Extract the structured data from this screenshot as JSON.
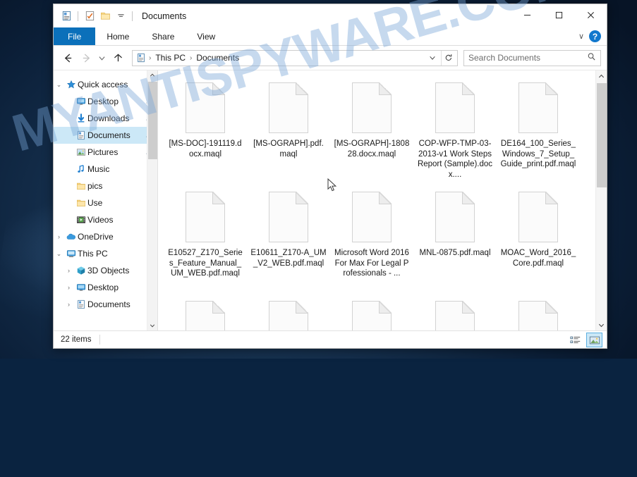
{
  "desktop": {
    "watermark": "MYANTISPYWARE.COM"
  },
  "window": {
    "title": "Documents",
    "quick_access_toolbar": [
      {
        "name": "properties-icon",
        "label": "Properties"
      },
      {
        "name": "new-folder-checklist-icon",
        "label": "New folder"
      },
      {
        "name": "folder-icon",
        "label": "Folder"
      },
      {
        "name": "customize-chevron-down-icon",
        "label": "Customize Quick Access Toolbar"
      }
    ],
    "controls": {
      "minimize": "─",
      "maximize": "□",
      "close": "✕"
    }
  },
  "ribbon": {
    "tabs": [
      {
        "label": "File",
        "active": true
      },
      {
        "label": "Home",
        "active": false
      },
      {
        "label": "Share",
        "active": false
      },
      {
        "label": "View",
        "active": false
      }
    ],
    "expand_label": "∨",
    "help_label": "?"
  },
  "address_bar": {
    "back": "←",
    "forward": "→",
    "recent": "∨",
    "up": "↑",
    "breadcrumbs": [
      "This PC",
      "Documents"
    ],
    "separator": "›",
    "dropdown": "∨",
    "refresh": "↻"
  },
  "search": {
    "placeholder": "Search Documents",
    "icon": "search-icon"
  },
  "sidebar": {
    "items": [
      {
        "label": "Quick access",
        "icon": "star-icon",
        "indent": 0,
        "chevron": "⌄",
        "expanded": true,
        "pinned": false,
        "selected": false
      },
      {
        "label": "Desktop",
        "icon": "desktop-icon",
        "indent": 1,
        "chevron": "",
        "expanded": false,
        "pinned": true,
        "selected": false
      },
      {
        "label": "Downloads",
        "icon": "download-icon",
        "indent": 1,
        "chevron": "",
        "expanded": false,
        "pinned": true,
        "selected": false
      },
      {
        "label": "Documents",
        "icon": "document-icon",
        "indent": 1,
        "chevron": "",
        "expanded": false,
        "pinned": true,
        "selected": true
      },
      {
        "label": "Pictures",
        "icon": "picture-icon",
        "indent": 1,
        "chevron": "",
        "expanded": false,
        "pinned": true,
        "selected": false
      },
      {
        "label": "Music",
        "icon": "music-note-icon",
        "indent": 1,
        "chevron": "",
        "expanded": false,
        "pinned": false,
        "selected": false
      },
      {
        "label": "pics",
        "icon": "folder-icon",
        "indent": 1,
        "chevron": "",
        "expanded": false,
        "pinned": false,
        "selected": false
      },
      {
        "label": "Use",
        "icon": "folder-icon",
        "indent": 1,
        "chevron": "",
        "expanded": false,
        "pinned": false,
        "selected": false
      },
      {
        "label": "Videos",
        "icon": "video-icon",
        "indent": 1,
        "chevron": "",
        "expanded": false,
        "pinned": false,
        "selected": false
      },
      {
        "label": "OneDrive",
        "icon": "cloud-icon",
        "indent": 0,
        "chevron": "›",
        "expanded": false,
        "pinned": false,
        "selected": false
      },
      {
        "label": "This PC",
        "icon": "pc-icon",
        "indent": 0,
        "chevron": "⌄",
        "expanded": true,
        "pinned": false,
        "selected": false
      },
      {
        "label": "3D Objects",
        "icon": "cube-icon",
        "indent": 1,
        "chevron": "›",
        "expanded": false,
        "pinned": false,
        "selected": false
      },
      {
        "label": "Desktop",
        "icon": "desktop-icon",
        "indent": 1,
        "chevron": "›",
        "expanded": false,
        "pinned": false,
        "selected": false
      },
      {
        "label": "Documents",
        "icon": "document-icon",
        "indent": 1,
        "chevron": "›",
        "expanded": false,
        "pinned": false,
        "selected": false
      }
    ]
  },
  "files": [
    {
      "name": "[MS-DOC]-191119.docx.maql",
      "icon": "blank-document-icon"
    },
    {
      "name": "[MS-OGRAPH].pdf.maql",
      "icon": "blank-document-icon"
    },
    {
      "name": "[MS-OGRAPH]-180828.docx.maql",
      "icon": "blank-document-icon"
    },
    {
      "name": "COP-WFP-TMP-03-2013-v1 Work Steps Report (Sample).docx....",
      "icon": "blank-document-icon"
    },
    {
      "name": "DE164_100_Series_Windows_7_Setup_Guide_print.pdf.maql",
      "icon": "blank-document-icon"
    },
    {
      "name": "E10527_Z170_Series_Feature_Manual_UM_WEB.pdf.maql",
      "icon": "blank-document-icon"
    },
    {
      "name": "E10611_Z170-A_UM_V2_WEB.pdf.maql",
      "icon": "blank-document-icon"
    },
    {
      "name": "Microsoft Word 2016 For Max For Legal Professionals - ...",
      "icon": "blank-document-icon"
    },
    {
      "name": "MNL-0875.pdf.maql",
      "icon": "blank-document-icon"
    },
    {
      "name": "MOAC_Word_2016_Core.pdf.maql",
      "icon": "blank-document-icon"
    },
    {
      "name": "",
      "icon": "blank-document-icon"
    },
    {
      "name": "",
      "icon": "blank-document-icon"
    },
    {
      "name": "",
      "icon": "blank-document-icon"
    },
    {
      "name": "",
      "icon": "blank-document-icon"
    },
    {
      "name": "",
      "icon": "blank-document-icon"
    }
  ],
  "status": {
    "item_count": "22 items",
    "views": [
      {
        "name": "details-view-button",
        "active": false
      },
      {
        "name": "large-icons-view-button",
        "active": true
      }
    ]
  },
  "colors": {
    "accent": "#0b70ba",
    "selection": "#cce8f7",
    "help_blue": "#1278cd"
  }
}
